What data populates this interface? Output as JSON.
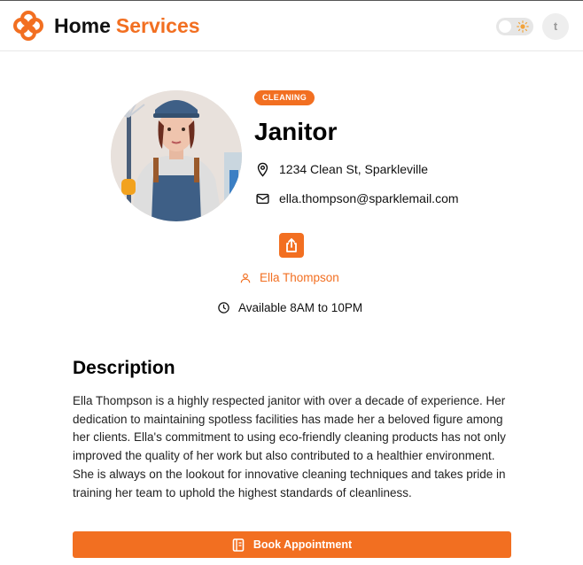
{
  "colors": {
    "accent": "#f26f21",
    "text": "#111111",
    "muted": "#9a9a9a"
  },
  "header": {
    "brand_first": "Home",
    "brand_second": "Services",
    "theme_toggle": {
      "state": "light",
      "icon": "sun-icon"
    },
    "user_avatar_initial": "t"
  },
  "service": {
    "category_badge": "CLEANING",
    "title": "Janitor",
    "address": "1234 Clean St, Sparkleville",
    "email": "ella.thompson@sparklemail.com",
    "share_icon": "share-icon",
    "provider_name": "Ella Thompson",
    "availability": "Available 8AM to 10PM"
  },
  "description": {
    "heading": "Description",
    "text": "Ella Thompson is a highly respected janitor with over a decade of experience. Her dedication to maintaining spotless facilities has made her a beloved figure among her clients. Ella's commitment to using eco-friendly cleaning products has not only improved the quality of her work but also contributed to a healthier environment. She is always on the lookout for innovative cleaning techniques and takes pride in training her team to uphold the highest standards of cleanliness."
  },
  "actions": {
    "book_label": "Book Appointment"
  }
}
